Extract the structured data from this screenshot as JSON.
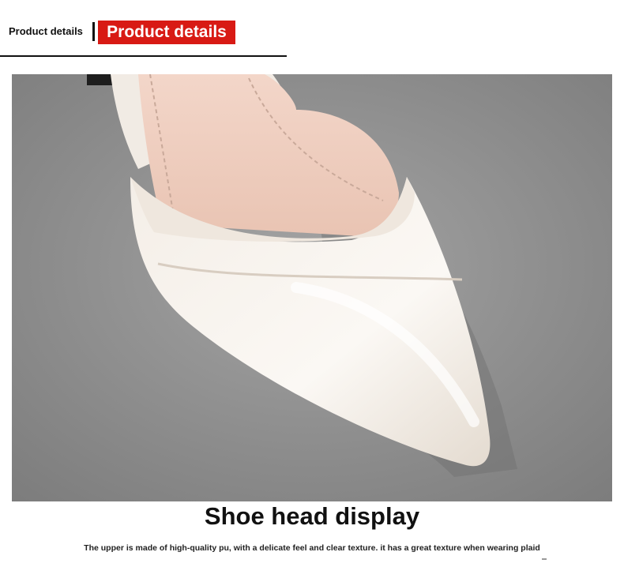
{
  "header": {
    "small_label": "Product details",
    "title": "Product details"
  },
  "photo": {
    "subject": "shoe-photo"
  },
  "headline": "Shoe head display",
  "description": "The upper is made of high-quality pu, with a delicate feel and clear texture. it has a great texture when wearing plaid",
  "colors": {
    "accent": "#d81a14",
    "background": "#ffffff",
    "text": "#111111"
  }
}
